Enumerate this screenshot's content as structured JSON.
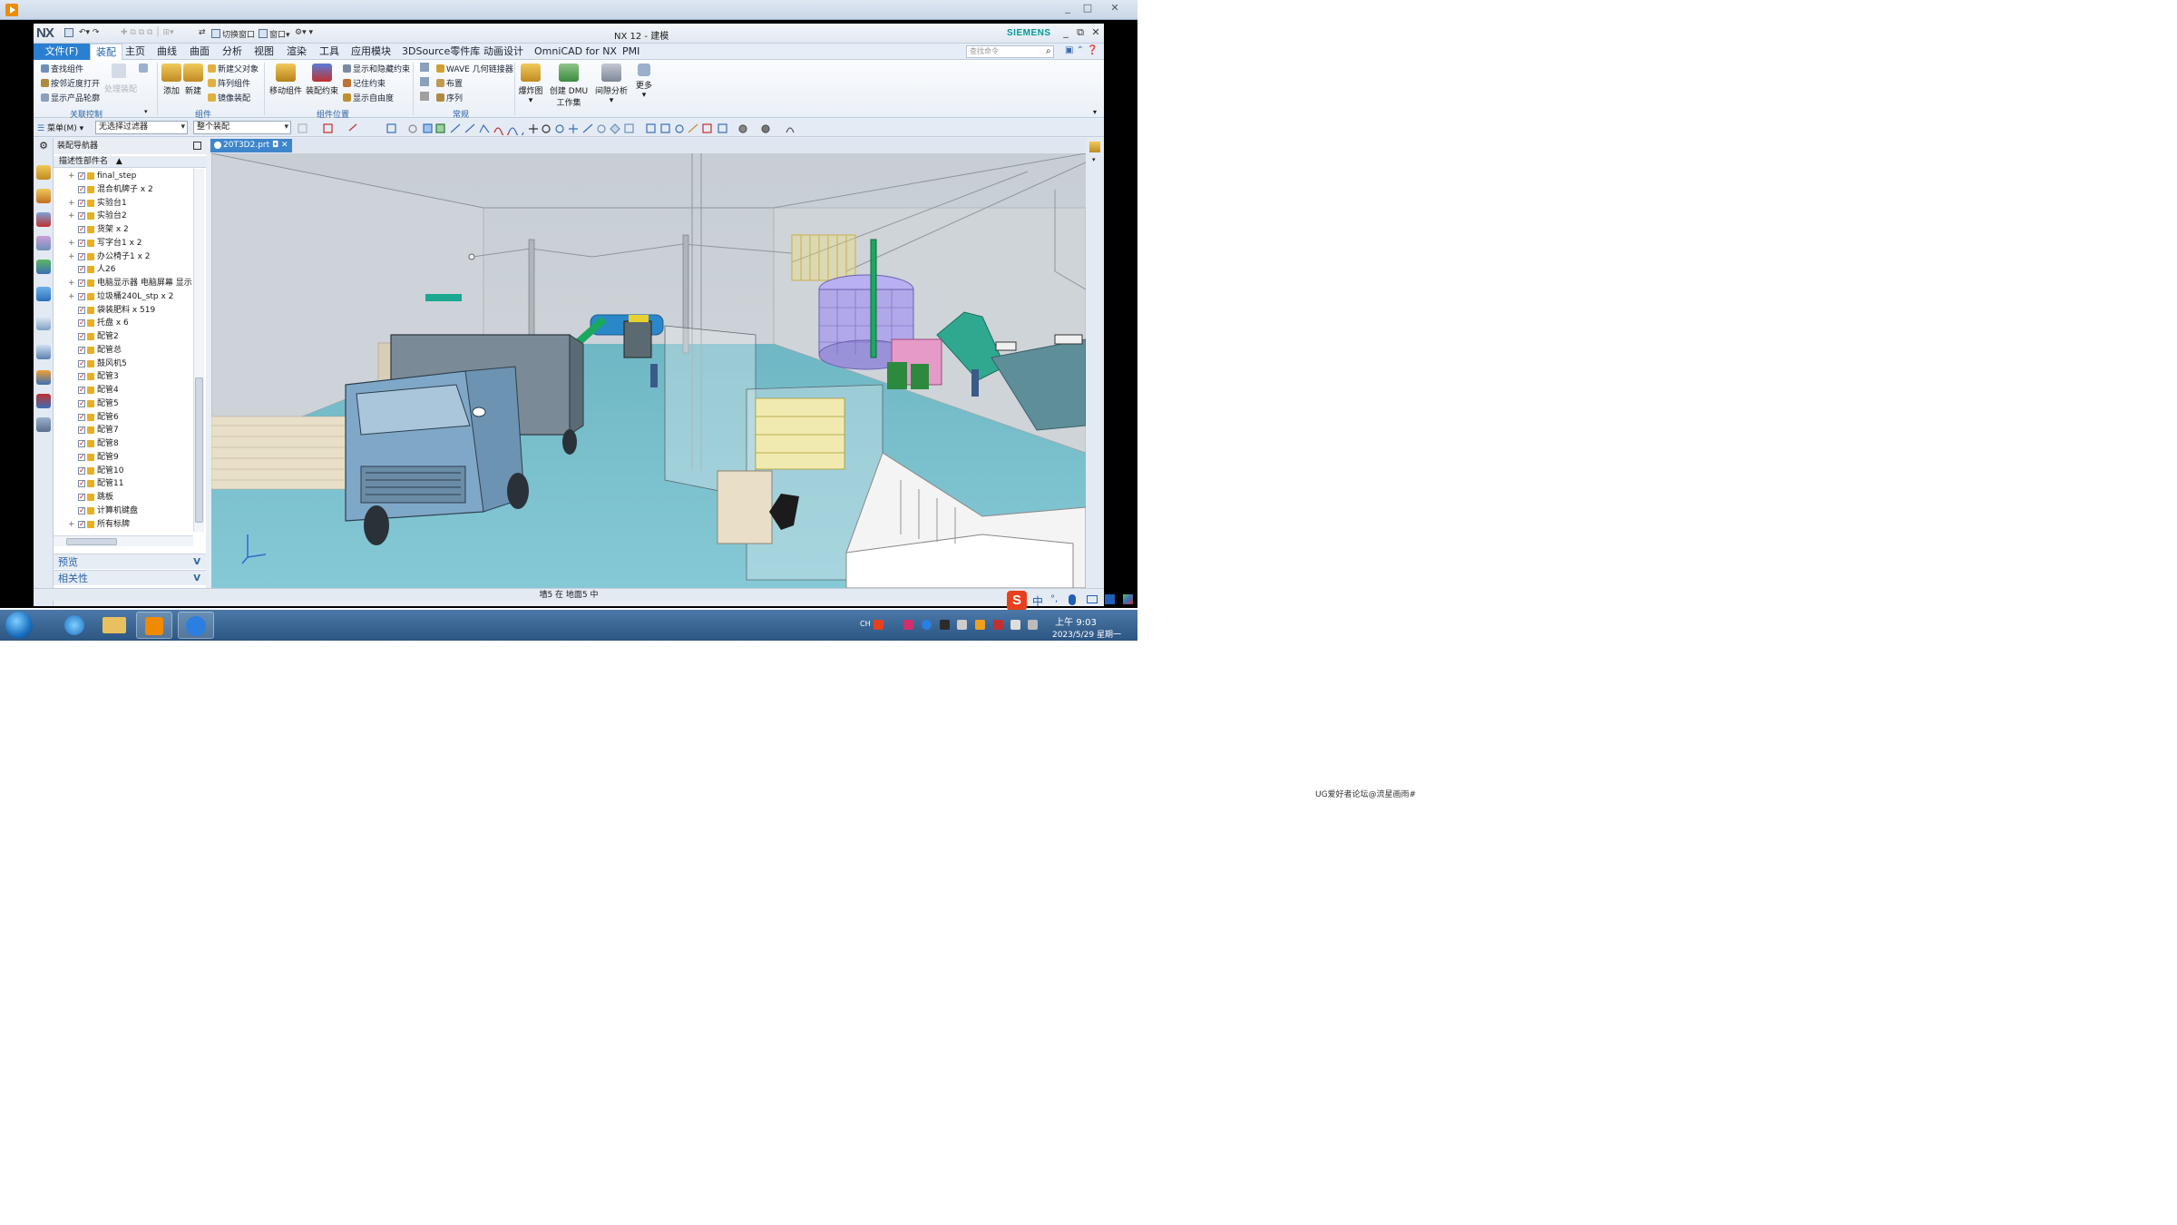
{
  "player": {
    "min": "_",
    "restore": "□",
    "close": "✕"
  },
  "window": {
    "logo": "NX",
    "title": "NX 12 - 建模",
    "brand": "SIEMENS",
    "min": "_",
    "restore": "⧉",
    "close": "✕"
  },
  "quick_access": {
    "switch_window": "切换窗口",
    "window": "窗口"
  },
  "menus": [
    "文件(F)",
    "装配",
    "主页",
    "曲线",
    "曲面",
    "分析",
    "视图",
    "渲染",
    "工具",
    "应用模块",
    "3DSource零件库",
    "动画设计",
    "OmniCAD for NX",
    "PMI"
  ],
  "search": {
    "placeholder": "查找命令"
  },
  "ribbon": {
    "assoc": {
      "items": [
        "查找组件",
        "按邻近度打开",
        "显示产品轮廓"
      ],
      "extra": "处理装配",
      "group": "关联控制"
    },
    "component": {
      "add": "添加",
      "new": "新建",
      "items": [
        "新建父对象",
        "阵列组件",
        "镜像装配"
      ],
      "group": "组件"
    },
    "position": {
      "move": "移动组件",
      "constraint": "装配约束",
      "items": [
        "显示和隐藏约束",
        "记住约束",
        "显示自由度"
      ],
      "group": "组件位置"
    },
    "general": {
      "items": [
        "WAVE 几何链接器",
        "布置",
        "序列"
      ],
      "group": "常规"
    },
    "explode": "爆炸图",
    "dmu": "创建 DMU\n工作集",
    "clearance": "间隙分析",
    "more": "更多"
  },
  "toolbar2": {
    "menu": "菜单(M)",
    "filter": "无选择过滤器",
    "scope": "整个装配"
  },
  "navigator": {
    "title": "装配导航器",
    "column": "描述性部件名",
    "rows": [
      {
        "label": "final_step",
        "expandable": true
      },
      {
        "label": "混合机牌子 x 2",
        "expandable": false
      },
      {
        "label": "实验台1",
        "expandable": true
      },
      {
        "label": "实验台2",
        "expandable": true
      },
      {
        "label": "货架 x 2",
        "expandable": false
      },
      {
        "label": "写字台1 x 2",
        "expandable": true
      },
      {
        "label": "办公椅子1 x 2",
        "expandable": true
      },
      {
        "label": "人26",
        "expandable": false
      },
      {
        "label": "电脑显示器 电脑屏幕 显示",
        "expandable": true
      },
      {
        "label": "垃圾桶240L_stp x 2",
        "expandable": true
      },
      {
        "label": "袋装肥料 x 519",
        "expandable": false
      },
      {
        "label": "托盘 x 6",
        "expandable": false
      },
      {
        "label": "配管2",
        "expandable": false
      },
      {
        "label": "配管总",
        "expandable": false
      },
      {
        "label": "鼓风机5",
        "expandable": false
      },
      {
        "label": "配管3",
        "expandable": false
      },
      {
        "label": "配管4",
        "expandable": false
      },
      {
        "label": "配管5",
        "expandable": false
      },
      {
        "label": "配管6",
        "expandable": false
      },
      {
        "label": "配管7",
        "expandable": false
      },
      {
        "label": "配管8",
        "expandable": false
      },
      {
        "label": "配管9",
        "expandable": false
      },
      {
        "label": "配管10",
        "expandable": false
      },
      {
        "label": "配管11",
        "expandable": false
      },
      {
        "label": "跳板",
        "expandable": false
      },
      {
        "label": "计算机键盘",
        "expandable": false
      },
      {
        "label": "所有标牌",
        "expandable": true
      }
    ],
    "panels": [
      "预览",
      "相关性"
    ]
  },
  "graphics_tab": "20T3D2.prt",
  "status": "墙5 在 地面5 中",
  "taskbar": {
    "time": "上午 9:03",
    "date": "2023/5/29 星期一",
    "lang": "CH"
  },
  "ime": {
    "mode": "中"
  },
  "watermark": "UG爱好者论坛@流星画雨#"
}
